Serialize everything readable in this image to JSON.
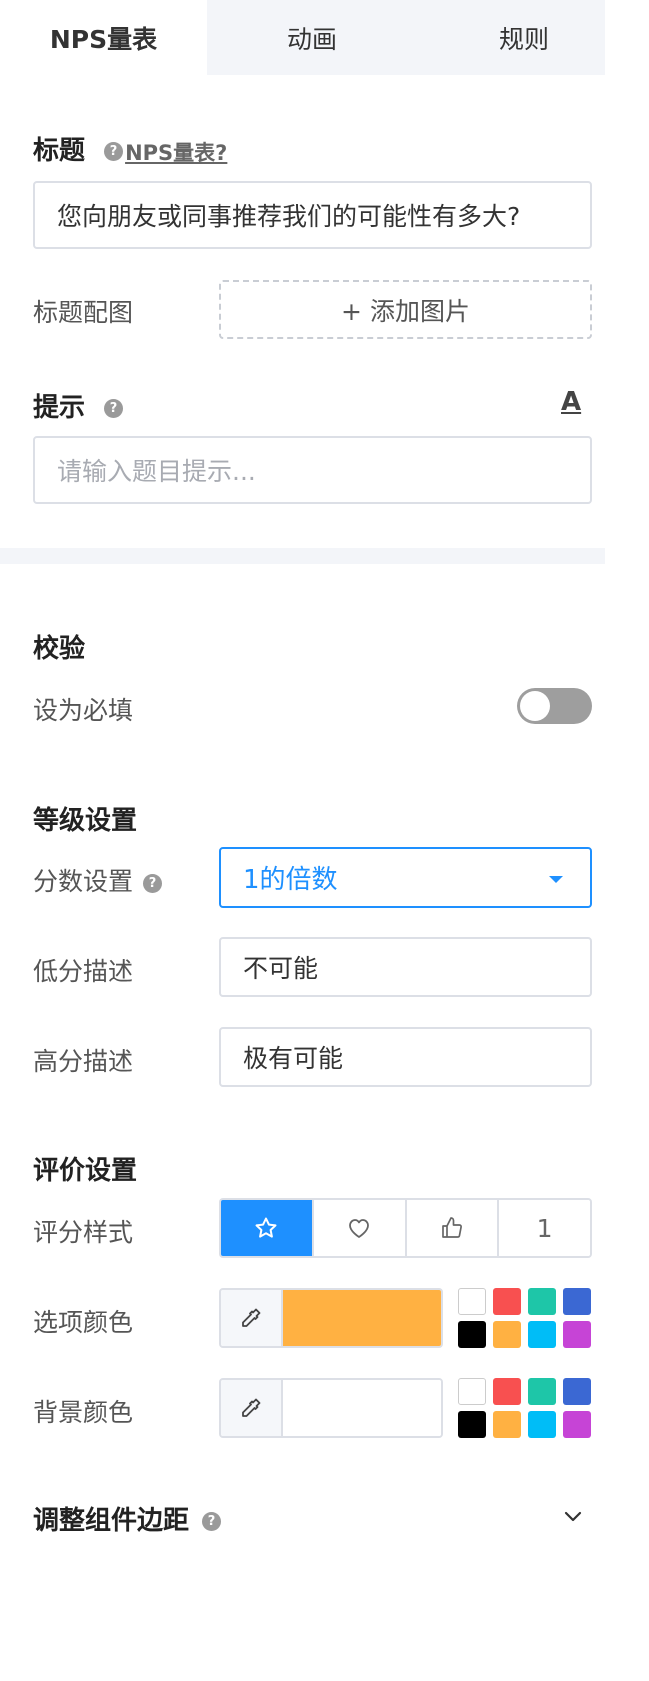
{
  "tabs": [
    {
      "label": "NPS量表"
    },
    {
      "label": "动画"
    },
    {
      "label": "规则"
    }
  ],
  "title_section": {
    "heading": "标题",
    "help_icon": "question-icon",
    "help_link": "NPS量表?",
    "title_value": "您向朋友或同事推荐我们的可能性有多大?",
    "image_label": "标题配图",
    "add_image": "+ 添加图片"
  },
  "hint_section": {
    "heading": "提示",
    "text_style_icon": "A",
    "placeholder": "请输入题目提示..."
  },
  "validation": {
    "heading": "校验",
    "required_label": "设为必填",
    "required_on": false
  },
  "level_settings": {
    "heading": "等级设置",
    "score_label": "分数设置",
    "score_value": "1的倍数",
    "low_label": "低分描述",
    "low_value": "不可能",
    "high_label": "高分描述",
    "high_value": "极有可能"
  },
  "rating_settings": {
    "heading": "评价设置",
    "style_label": "评分样式",
    "styles": [
      "star-icon",
      "heart-icon",
      "thumbs-up-icon",
      "1"
    ],
    "selected_style": 0,
    "option_color_label": "选项颜色",
    "option_color": "#ffb142",
    "bg_color_label": "背景颜色",
    "bg_color": "#ffffff",
    "palette": [
      "#ffffff",
      "#f85050",
      "#1ec6a8",
      "#3b68d3",
      "#000000",
      "#ffb142",
      "#00bdf7",
      "#c644d6"
    ]
  },
  "margin_section": {
    "heading": "调整组件边距"
  },
  "colors": {
    "accent": "#1e90ff"
  }
}
